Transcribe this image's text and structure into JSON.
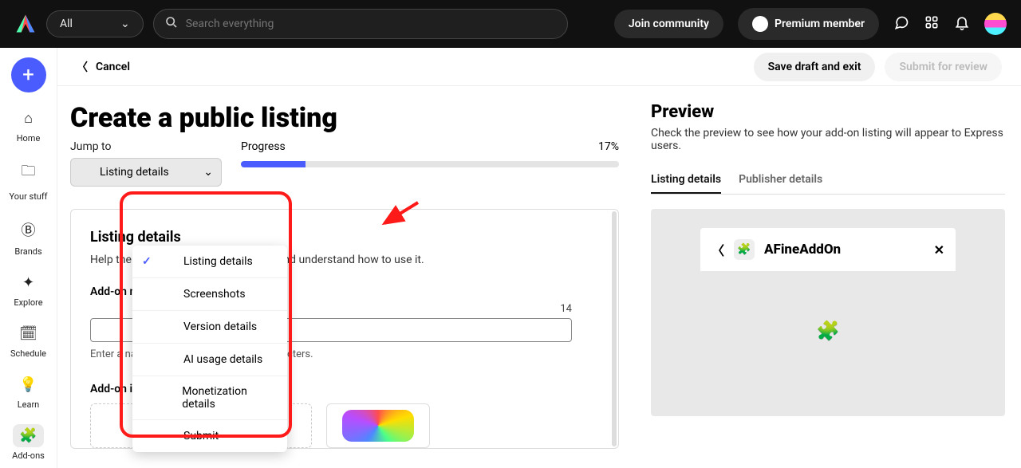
{
  "topbar": {
    "allLabel": "All",
    "searchPlaceholder": "Search everything",
    "joinCommunity": "Join community",
    "premium": "Premium member"
  },
  "sidebar": {
    "items": [
      {
        "label": "Home"
      },
      {
        "label": "Your stuff"
      },
      {
        "label": "Brands"
      },
      {
        "label": "Explore"
      },
      {
        "label": "Schedule"
      },
      {
        "label": "Learn"
      },
      {
        "label": "Add-ons"
      }
    ]
  },
  "subheader": {
    "cancel": "Cancel",
    "saveDraft": "Save draft and exit",
    "submit": "Submit for review"
  },
  "page": {
    "title": "Create a public listing",
    "jumpTo": "Jump to",
    "jumpSelected": "Listing details",
    "progressLabel": "Progress",
    "progressPct": "17%",
    "jumpOptions": [
      "Listing details",
      "Screenshots",
      "Version details",
      "AI usage details",
      "Monetization details",
      "Submit"
    ]
  },
  "listingCard": {
    "title": "Listing details",
    "desc": "Help the user to discover your add-on and understand how to use it.",
    "nameLabel": "Add-on name",
    "charRemaining": "14",
    "hint": "Enter a name that's fun and under 25 characters.",
    "iconLabel": "Add-on icon"
  },
  "preview": {
    "heading": "Preview",
    "sub": "Check the preview to see how your add-on listing will appear to Express users.",
    "tabs": [
      "Listing details",
      "Publisher details"
    ],
    "addonName": "AFineAddOn"
  }
}
